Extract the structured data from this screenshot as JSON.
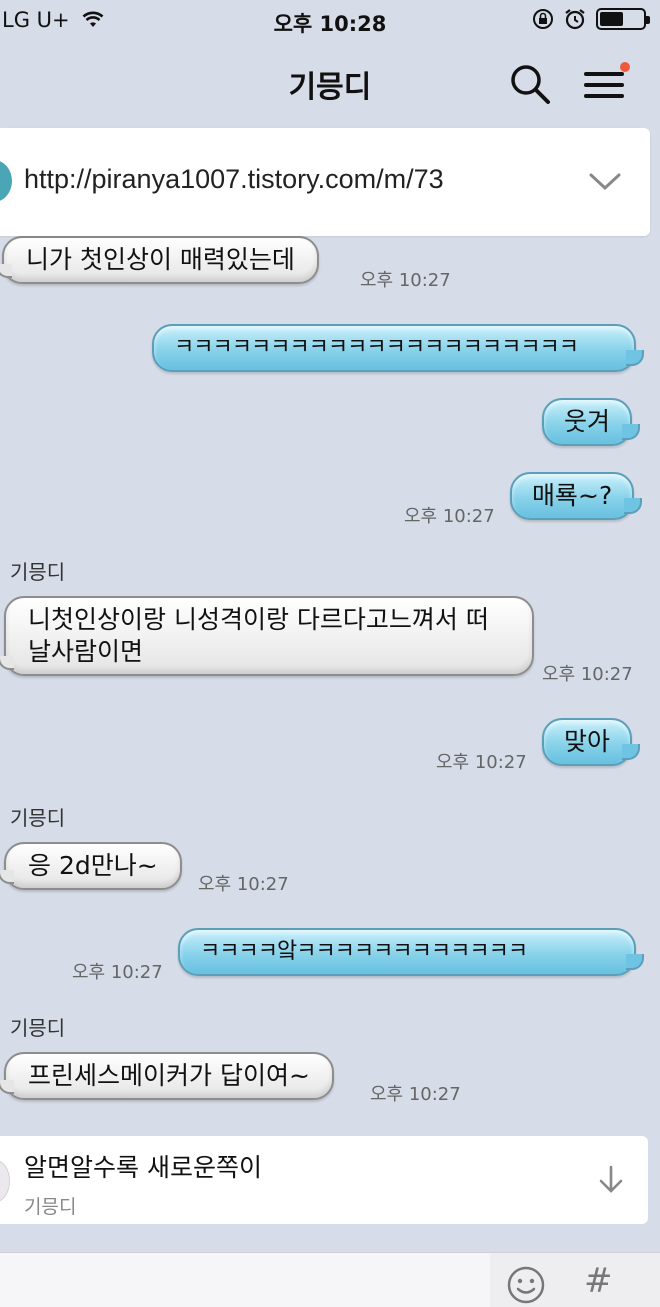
{
  "status": {
    "carrier": "LG U+",
    "time": "오후 10:28"
  },
  "header": {
    "title": "기믕디"
  },
  "notice": {
    "text": "http://piranya1007.tistory.com/m/73"
  },
  "messages": [
    {
      "dir": "in",
      "text": "니가 첫인상이 매력있는데",
      "time": "오후 10:27"
    },
    {
      "dir": "out",
      "text": "ㅋㅋㅋㅋㅋㅋㅋㅋㅋㅋㅋㅋㅋㅋㅋㅋㅋㅋㅋㅋㅋ"
    },
    {
      "dir": "out",
      "text": "웃겨"
    },
    {
      "dir": "out",
      "text": "매룍~?",
      "time": "오후 10:27"
    },
    {
      "sender": "기믕디"
    },
    {
      "dir": "in",
      "text": "니첫인상이랑 니성격이랑 다르다고느껴서 떠날사람이면",
      "time": "오후 10:27"
    },
    {
      "dir": "out",
      "text": "맞아",
      "time": "오후 10:27"
    },
    {
      "sender": "기믕디"
    },
    {
      "dir": "in",
      "text": "응 2d만나~",
      "time": "오후 10:27"
    },
    {
      "dir": "out",
      "text": "ㅋㅋㅋㅋ앜ㅋㅋㅋㅋㅋㅋㅋㅋㅋㅋㅋㅋ",
      "time": "오후 10:27"
    },
    {
      "sender": "기믕디"
    },
    {
      "dir": "in",
      "text": "프린세스메이커가 답이여~",
      "time": "오후 10:27"
    }
  ],
  "announce": {
    "title": "알면알수록 새로운쪽이",
    "author": "기믕디"
  },
  "input": {
    "placeholder": "",
    "hash_label": "#"
  },
  "icons": {
    "wifi": "wifi-icon",
    "lock": "rotation-lock-icon",
    "alarm": "alarm-icon",
    "battery": "battery-icon",
    "search": "search-icon",
    "menu": "menu-icon",
    "chevron": "chevron-down-icon",
    "arrow": "arrow-down-icon",
    "emoji": "emoji-icon"
  },
  "colors": {
    "background": "#d6dce8",
    "outgoing_bubble": "#88d2ea",
    "incoming_bubble": "#f2f2f2",
    "notification_dot": "#f05a3c"
  },
  "battery_level": 0.55
}
